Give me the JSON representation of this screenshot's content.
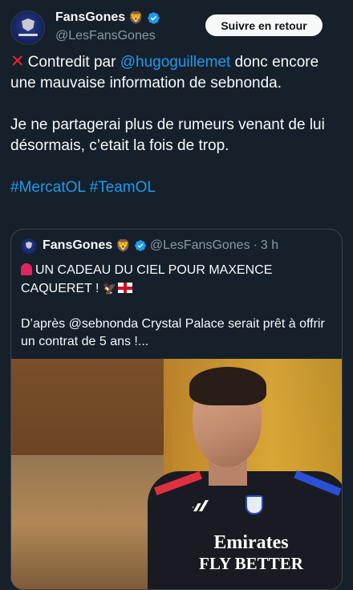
{
  "author": {
    "display_name": "FansGones",
    "name_emoji": "🦁",
    "handle": "@LesFansGones"
  },
  "follow_button": {
    "label": "Suivre en retour"
  },
  "tweet": {
    "line1_prefix_icon": "cross-mark-icon",
    "line1_before": "Contredit par ",
    "line1_mention": "@hugoguillemet",
    "line1_after": " donc encore une mauvaise information de sebnonda.",
    "line2": "Je ne partagerai plus de rumeurs venant de lui désormais, c’etait la fois de trop.",
    "hashtag1": "#MercatOL",
    "hashtag2": "#TeamOL"
  },
  "quoted": {
    "display_name": "FansGones",
    "name_emoji": "🦁",
    "handle": "@LesFansGones",
    "separator": "·",
    "time": "3 h",
    "headline": "UN CADEAU DU CIEL POUR MAXENCE CAQUERET !",
    "headline_emojis": [
      "siren-icon",
      "eagle-icon",
      "england-flag-icon"
    ],
    "body": "D’après @sebnonda Crystal Palace serait prêt à offrir un contrat de 5 ans !...",
    "image": {
      "sponsor_text_line1": "Emirates",
      "sponsor_text_line2": "FLY BETTER"
    }
  },
  "colors": {
    "background": "#15202b",
    "text": "#f7f9f9",
    "secondary": "#8b98a5",
    "link": "#1d9bf0",
    "verified": "#1d9bf0",
    "border": "#38444d"
  }
}
